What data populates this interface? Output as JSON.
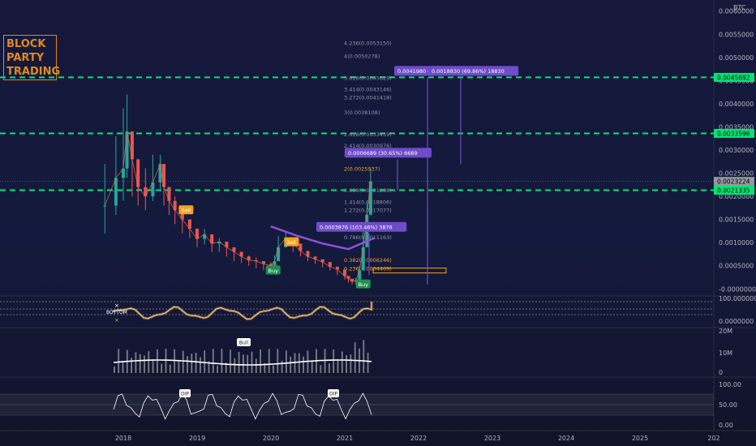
{
  "header": {
    "currency": "BTC"
  },
  "logo": {
    "line1": "BLOCK",
    "line2": "PARTY",
    "line3": "TRADING"
  },
  "colors": {
    "background": "#131722",
    "candle_up": "#26a69a",
    "candle_down": "#ef5350",
    "fib_orange": "#f7a21b",
    "green_level": "#00e676",
    "measure": "#6f4cc9",
    "trend_purple": "#8d52d9"
  },
  "chart_data": [
    {
      "type": "candlestick",
      "pair_quote": "BTC",
      "x_axis": {
        "ticks": [
          "2018",
          "2019",
          "2020",
          "2021",
          "2022",
          "2023",
          "2024",
          "2025",
          "202"
        ]
      },
      "y_axis": {
        "scale": "linear",
        "range": [
          -0.0001,
          0.0061
        ],
        "ticks": [
          "0.0060000",
          "0.0055000",
          "0.0050000",
          "0.0045000",
          "0.0040000",
          "0.0035000",
          "0.0030000",
          "0.0025000",
          "0.0020000",
          "0.0015000",
          "0.0010000",
          "0.0005000",
          "-0.0000000"
        ],
        "tick_values": [
          0.006,
          0.0055,
          0.005,
          0.0045,
          0.004,
          0.0035,
          0.003,
          0.0025,
          0.002,
          0.0015,
          0.001,
          0.0005,
          0.0
        ]
      },
      "price_tags": [
        {
          "label": "0.0045692",
          "value": 0.0045692,
          "style": "green"
        },
        {
          "label": "0.0033596",
          "value": 0.0033596,
          "style": "green"
        },
        {
          "label": "0.0023224",
          "value": 0.0023224,
          "style": "gray",
          "sub": "2d 9h"
        },
        {
          "label": "0.0021335",
          "value": 0.0021335,
          "style": "green"
        }
      ],
      "horizontal_levels": [
        0.0045692,
        0.0033596,
        0.0021335
      ],
      "current_price": 0.0023224,
      "fib_levels": [
        {
          "label": "4.236(0.0053150)",
          "value": 0.005315,
          "color": "gray"
        },
        {
          "label": "4(0.0050278)",
          "value": 0.0050278,
          "color": "gray"
        },
        {
          "label": "3.618(0.0045629)",
          "value": 0.0045629,
          "color": "gray"
        },
        {
          "label": "3.414(0.0043146)",
          "value": 0.0043146,
          "color": "gray"
        },
        {
          "label": "3.272(0.0041418)",
          "value": 0.0041418,
          "color": "gray"
        },
        {
          "label": "3(0.0038108)",
          "value": 0.0038108,
          "color": "gray"
        },
        {
          "label": "2.618(0.0033459)",
          "value": 0.0033459,
          "color": "gray"
        },
        {
          "label": "2.414(0.0030976)",
          "value": 0.0030976,
          "color": "gray"
        },
        {
          "label": "2.272(0.0029248)",
          "value": 0.0029248,
          "color": "gray"
        },
        {
          "label": "2(0.0025937)",
          "value": 0.0025937,
          "color": "orange"
        },
        {
          "label": "1.618(0.0021288)",
          "value": 0.0021288,
          "color": "gray"
        },
        {
          "label": "1.414(0.0018806)",
          "value": 0.0018806,
          "color": "gray"
        },
        {
          "label": "1.272(0.0017077)",
          "value": 0.0017077,
          "color": "gray"
        },
        {
          "label": "1(0.0013767)",
          "value": 0.0013767,
          "color": "gray"
        },
        {
          "label": "0.786(0.0011163)",
          "value": 0.0011163,
          "color": "gray"
        },
        {
          "label": "0.382(0.0006246)",
          "value": 0.0006246,
          "color": "orange"
        },
        {
          "label": "0.236(0.0004469)",
          "value": 0.0004469,
          "color": "orange"
        }
      ],
      "measurements": [
        {
          "label": "0.0041980 (1",
          "value_from": 0.0001,
          "value_to": 0.0045692
        },
        {
          "label": "0.0018830 (69.86%) 18830",
          "value_from": 0.0026936,
          "value_to": 0.0045692
        },
        {
          "label": "0.0006689 (30.65%) 6689",
          "value_from": 0.0021335,
          "value_to": 0.0028
        },
        {
          "label": "0.0003876 (103.46%) 3876",
          "value_from": 0.0003,
          "value_to": 0.0012
        }
      ],
      "signals": [
        {
          "label": "Sell",
          "type": "sell",
          "date": 2018.85,
          "value": 0.0017
        },
        {
          "label": "Sell",
          "type": "sell",
          "date": 2020.28,
          "value": 0.00101
        },
        {
          "label": "Buy",
          "type": "buy",
          "date": 2020.03,
          "value": 0.0004
        },
        {
          "label": "Buy",
          "type": "buy",
          "date": 2021.25,
          "value": 0.0001
        }
      ],
      "series": [
        {
          "name": "",
          "x": [
            2017.75,
            2017.9,
            2018.0,
            2018.05,
            2018.12,
            2018.2,
            2018.3,
            2018.4,
            2018.5,
            2018.55,
            2018.62,
            2018.7,
            2018.8,
            2018.9,
            2019.0,
            2019.1,
            2019.2,
            2019.3,
            2019.4,
            2019.5,
            2019.6,
            2019.7,
            2019.8,
            2019.9,
            2020.0,
            2020.05,
            2020.1,
            2020.2,
            2020.3,
            2020.4,
            2020.5,
            2020.6,
            2020.7,
            2020.8,
            2020.9,
            2021.0,
            2021.05,
            2021.1,
            2021.15,
            2021.2,
            2021.25,
            2021.3,
            2021.35
          ],
          "values": [
            0.0018,
            0.0024,
            0.0026,
            0.0034,
            0.0028,
            0.0022,
            0.002,
            0.0023,
            0.0027,
            0.0022,
            0.0019,
            0.0017,
            0.0015,
            0.0013,
            0.00108,
            0.00118,
            0.00098,
            0.00102,
            0.0009,
            0.0008,
            0.0007,
            0.00062,
            0.0006,
            0.00054,
            0.0005,
            0.0006,
            0.0009,
            0.0011,
            0.00098,
            0.00082,
            0.0007,
            0.00064,
            0.00058,
            0.00048,
            0.00042,
            0.00028,
            0.00022,
            0.00016,
            0.00018,
            0.0004,
            0.0009,
            0.0016,
            0.0023224
          ],
          "highs": [
            0.0027,
            0.0033,
            0.0039,
            0.0042,
            0.0034,
            0.0028,
            0.0026,
            0.0029,
            0.0029,
            0.0026,
            0.0022,
            0.002,
            0.0017,
            0.0015,
            0.0012,
            0.0013,
            0.0011,
            0.0011,
            0.001,
            0.0009,
            0.0008,
            0.00072,
            0.00068,
            0.0006,
            0.00058,
            0.00072,
            0.00114,
            0.00124,
            0.00106,
            0.00092,
            0.00078,
            0.0007,
            0.00062,
            0.00054,
            0.00048,
            0.00034,
            0.00028,
            0.0002,
            0.00024,
            0.0005,
            0.00126,
            0.0019,
            0.0026
          ],
          "lows": [
            0.0012,
            0.0016,
            0.0019,
            0.0024,
            0.002,
            0.0018,
            0.0017,
            0.0019,
            0.0021,
            0.0018,
            0.0016,
            0.0014,
            0.0012,
            0.0011,
            0.0009,
            0.00096,
            0.0008,
            0.0008,
            0.0007,
            0.0006,
            0.00056,
            0.0005,
            0.00044,
            0.0004,
            0.0004,
            0.0005,
            0.0007,
            0.0009,
            0.0008,
            0.0007,
            0.0006,
            0.00054,
            0.00046,
            0.0004,
            0.0003,
            0.0002,
            0.00014,
            0.0001,
            0.0001,
            0.00018,
            0.0004,
            0.0009,
            0.0017
          ]
        }
      ],
      "trendline": [
        [
          2020.0,
          0.00135
        ],
        [
          2020.35,
          0.00115
        ],
        [
          2020.7,
          0.00098
        ],
        [
          2021.05,
          0.00086
        ],
        [
          2021.4,
          0.0011
        ]
      ]
    },
    {
      "type": "line",
      "pane": "oscillator",
      "y_axis": {
        "ticks": [
          "100.0000000",
          "0.0000000"
        ],
        "tick_values": [
          100,
          0
        ]
      },
      "labels": [
        "BOTTOM"
      ]
    },
    {
      "type": "bar",
      "pane": "volume",
      "y_axis": {
        "ticks": [
          "20M",
          "10M",
          "0"
        ],
        "tick_values": [
          20,
          10,
          0
        ]
      },
      "labels": [
        "Bull"
      ]
    },
    {
      "type": "line",
      "pane": "rsi",
      "y_axis": {
        "ticks": [
          "100.00",
          "50.00",
          "0.00"
        ],
        "tick_values": [
          100,
          50,
          0
        ]
      },
      "labels": [
        "DIP",
        "DIP"
      ]
    }
  ]
}
